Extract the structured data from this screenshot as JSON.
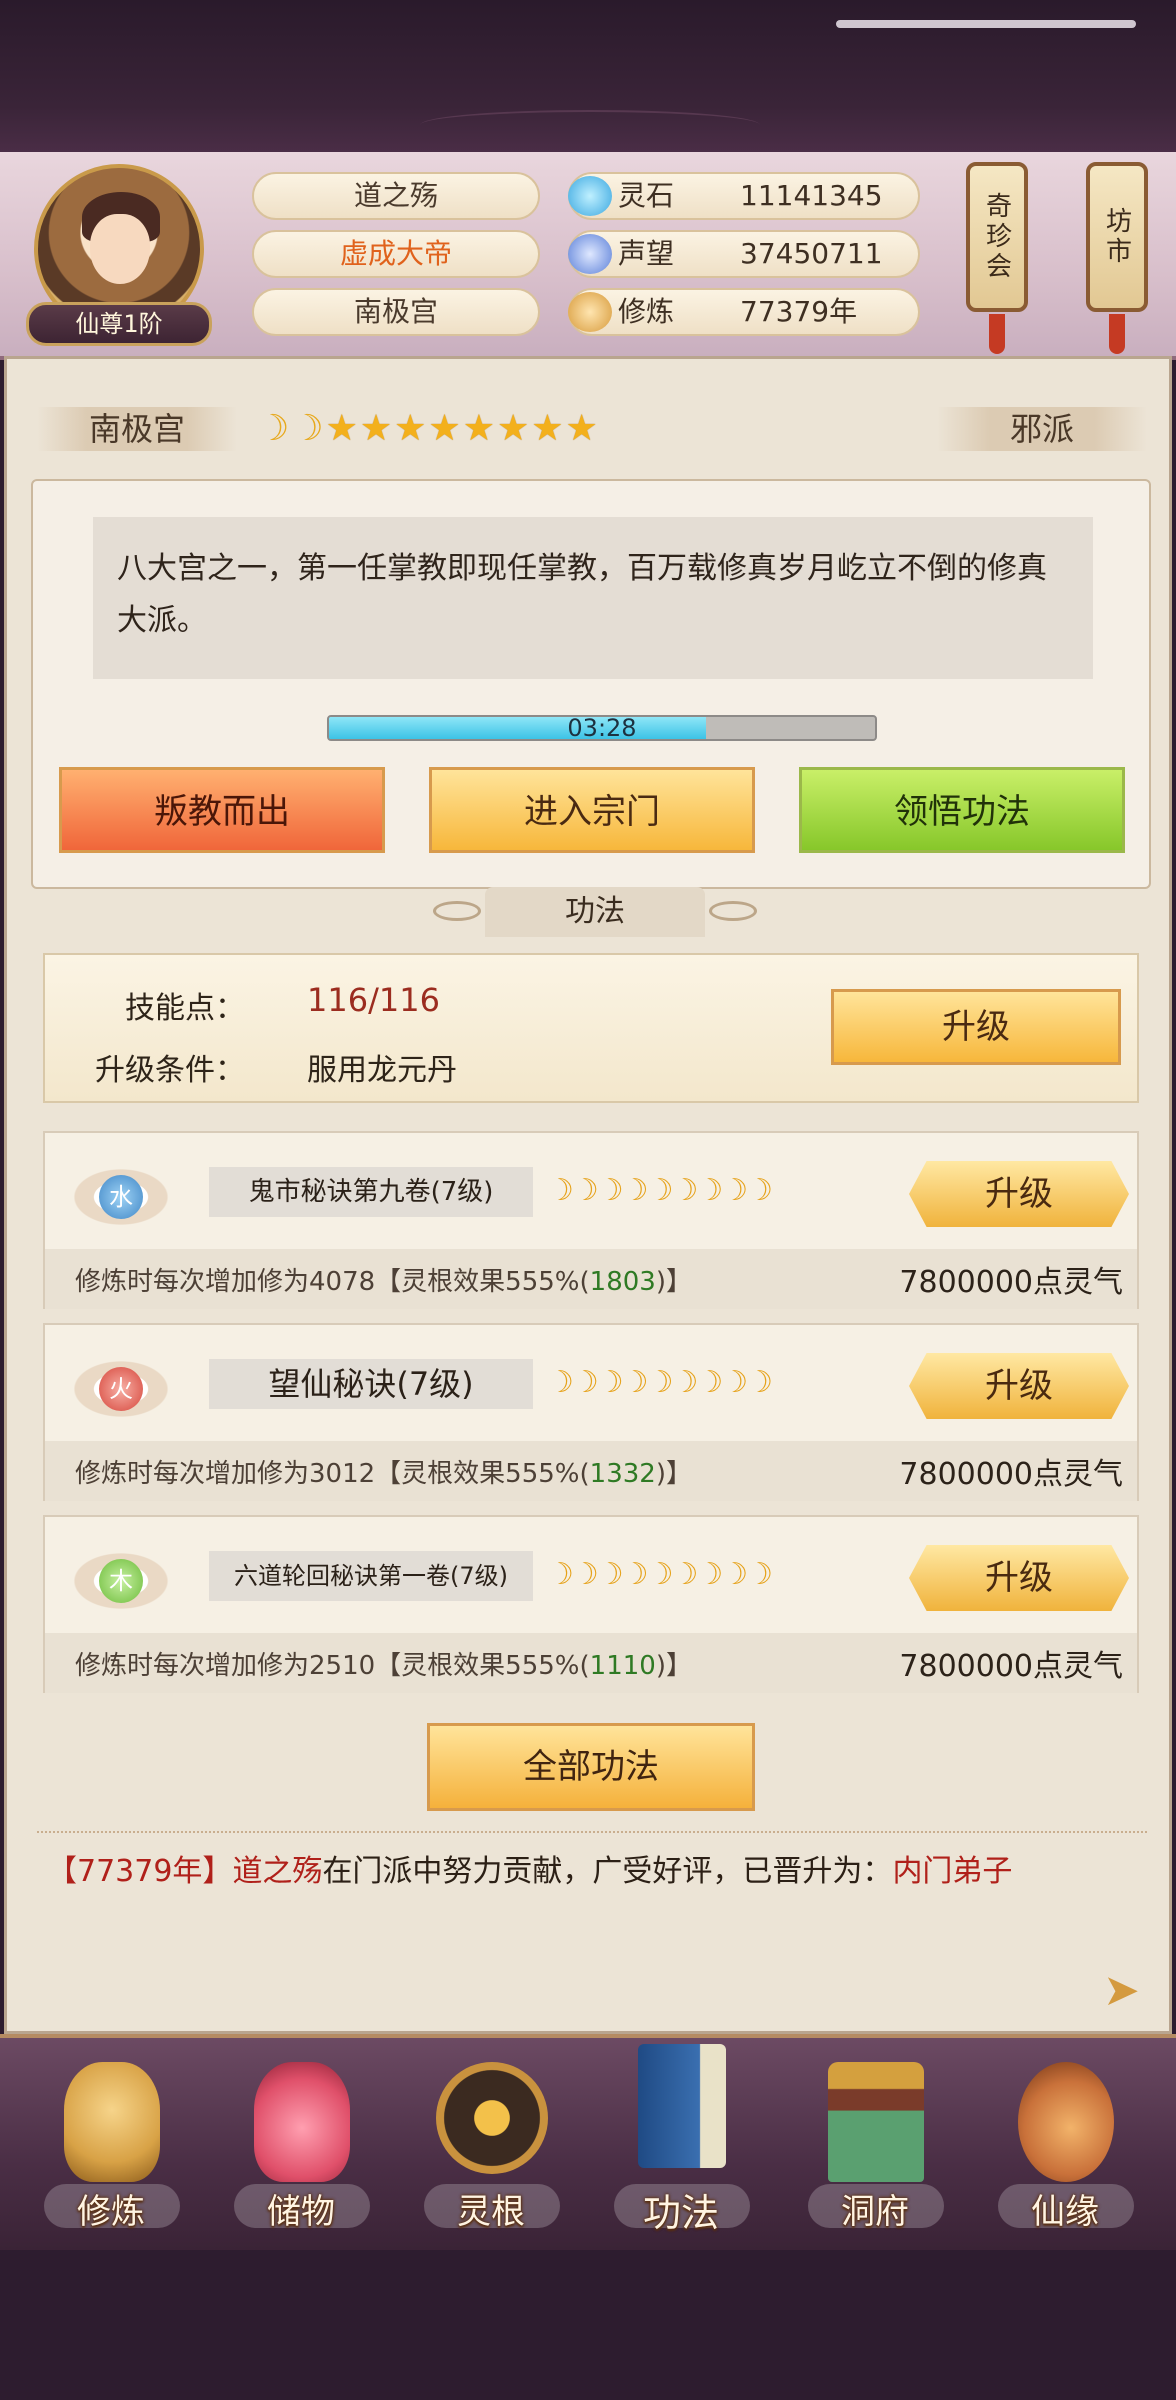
{
  "player": {
    "name": "道之殇",
    "title": "虚成大帝",
    "sect": "南极宫",
    "rank": "仙尊1阶"
  },
  "resources": [
    {
      "label": "灵石",
      "value": "11141345",
      "icon": "spirit-stone-icon",
      "color": "#3aa7e0"
    },
    {
      "label": "声望",
      "value": "37450711",
      "icon": "reputation-icon",
      "color": "#5a7fd8"
    },
    {
      "label": "修炼",
      "value": "77379年",
      "icon": "meditation-icon",
      "color": "#d79a3a"
    }
  ],
  "shops": {
    "left": "奇珍会",
    "right": "坊市"
  },
  "sect_panel": {
    "name": "南极宫",
    "alignment": "邪派",
    "rating": {
      "moons": 2,
      "stars": 8
    },
    "description": "八大宫之一，第一任掌教即现任掌教，百万载修真岁月屹立不倒的修真大派。",
    "timer": "03:28",
    "timer_progress": 0.69,
    "buttons": {
      "leave": "叛教而出",
      "enter": "进入宗门",
      "comprehend": "领悟功法"
    }
  },
  "gongfa": {
    "title": "功法",
    "skill_points_label": "技能点：",
    "skill_points_value": "116/116",
    "upgrade_cond_label": "升级条件：",
    "upgrade_cond_value": "服用龙元丹",
    "upgrade_button": "升级",
    "techniques": [
      {
        "element": "水",
        "element_color": "#3f86c6",
        "name": "鬼市秘诀第九卷(7级)",
        "moons": 9,
        "button": "升级",
        "effect_prefix": "修炼时每次增加修为4078【灵根效果555%(",
        "effect_bonus": "1803",
        "effect_suffix": ")】",
        "cost": "7800000点灵气"
      },
      {
        "element": "火",
        "element_color": "#d6453a",
        "name": "望仙秘诀(7级)",
        "moons": 9,
        "button": "升级",
        "effect_prefix": "修炼时每次增加修为3012【灵根效果555%(",
        "effect_bonus": "1332",
        "effect_suffix": ")】",
        "cost": "7800000点灵气"
      },
      {
        "element": "木",
        "element_color": "#6cbc3a",
        "name": "六道轮回秘诀第一卷(7级)",
        "moons": 9,
        "button": "升级",
        "effect_prefix": "修炼时每次增加修为2510【灵根效果555%(",
        "effect_bonus": "1110",
        "effect_suffix": ")】",
        "cost": "7800000点灵气"
      }
    ],
    "all_button": "全部功法"
  },
  "log": {
    "year": "【77379年】",
    "name": "道之殇",
    "text": "在门派中努力贡献，广受好评，已晋升为：",
    "rank": "内门弟子"
  },
  "nav": [
    {
      "label": "修炼",
      "icon": "cultivate-icon",
      "color": "#d8a246"
    },
    {
      "label": "储物",
      "icon": "storage-bag-icon",
      "color": "#e0506a"
    },
    {
      "label": "灵根",
      "icon": "spirit-root-icon",
      "color": "#8a5a2a"
    },
    {
      "label": "功法",
      "icon": "technique-book-icon",
      "color": "#3a6fb0"
    },
    {
      "label": "洞府",
      "icon": "cave-dwelling-icon",
      "color": "#5aa070"
    },
    {
      "label": "仙缘",
      "icon": "fortune-gourd-icon",
      "color": "#c9713a"
    }
  ]
}
